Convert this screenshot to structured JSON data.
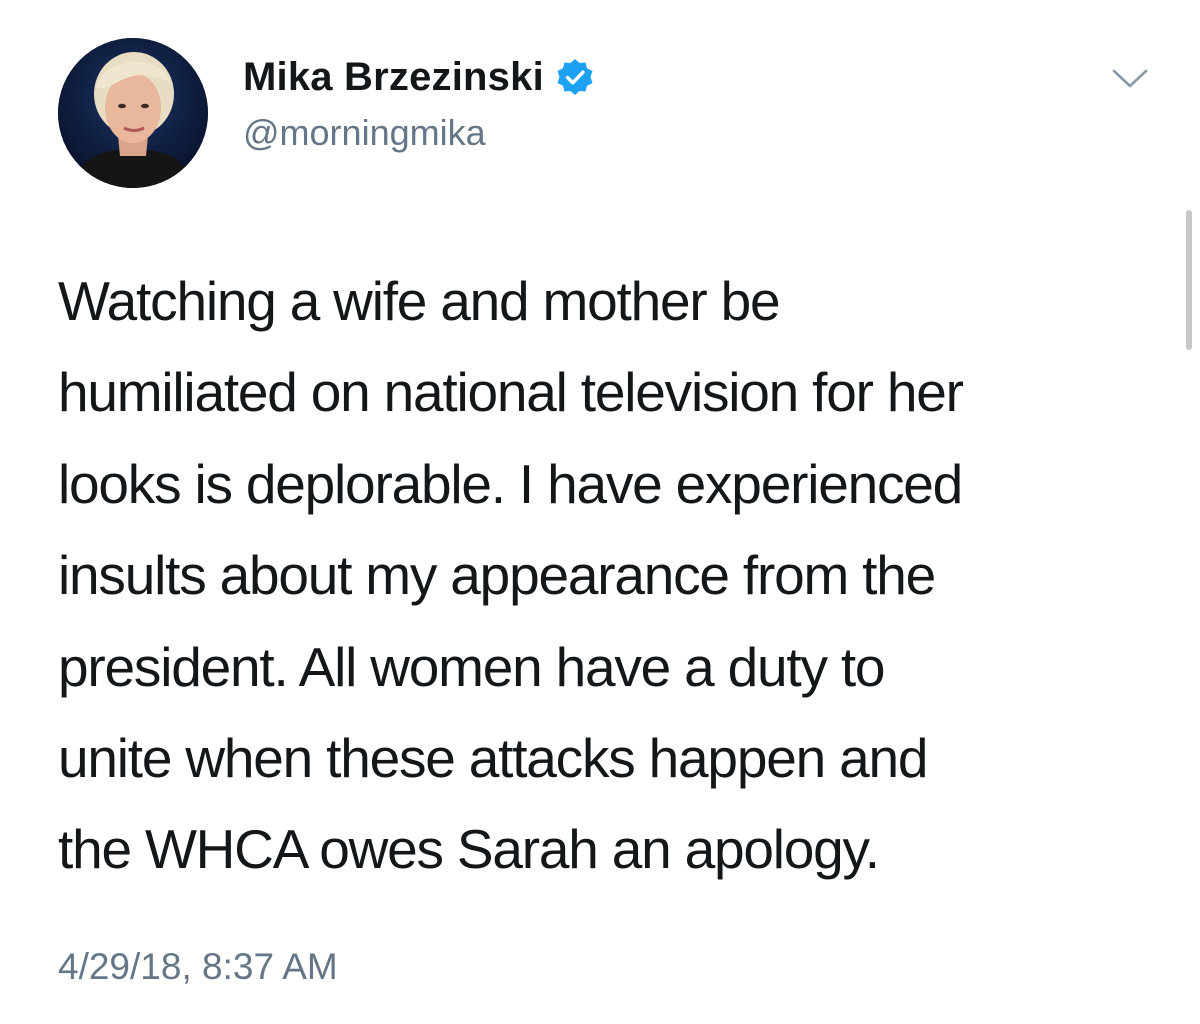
{
  "author": {
    "display_name": "Mika Brzezinski",
    "handle": "@morningmika",
    "verified": true,
    "avatar_icon": "profile-photo"
  },
  "tweet": {
    "text": "Watching a wife and mother be\nhumiliated on national television for her\nlooks is deplorable. I have experienced\ninsults about my appearance from the\npresident. All women have a duty to\nunite when these attacks happen and\nthe WHCA owes Sarah an apology.",
    "timestamp": "4/29/18, 8:37 AM"
  },
  "icons": {
    "verified": "verified-badge-icon",
    "menu": "chevron-down-icon"
  },
  "colors": {
    "verified_blue": "#1da1f2",
    "secondary_text": "#657786",
    "primary_text": "#14171a"
  }
}
